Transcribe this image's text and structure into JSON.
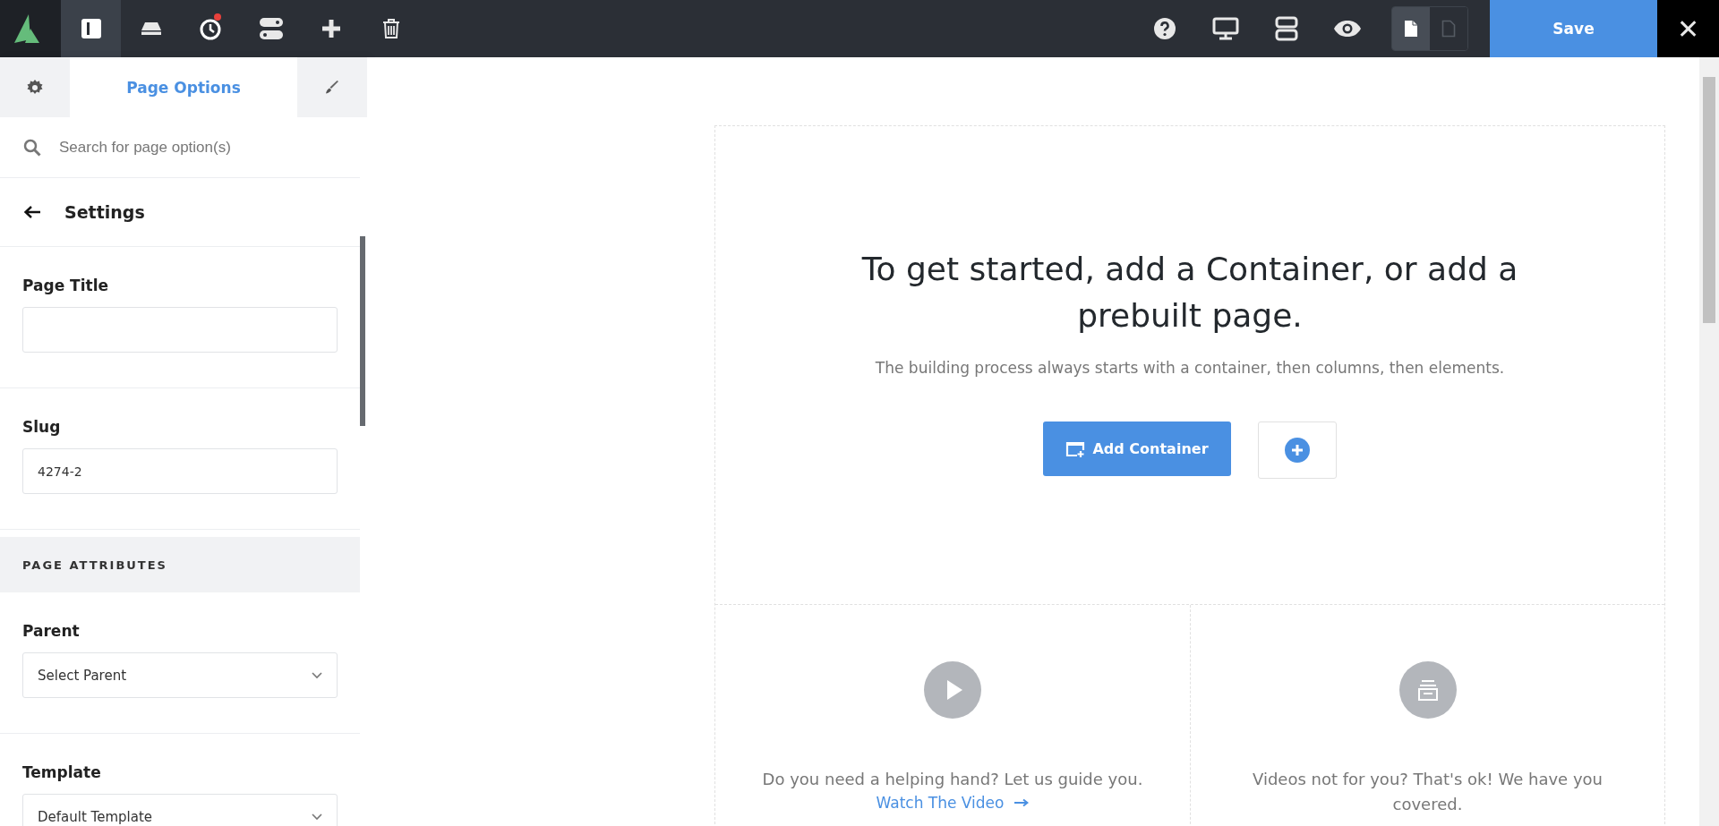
{
  "toolbar": {
    "left_tools": [
      {
        "kind": "sidebar",
        "selected": true,
        "notification": false
      },
      {
        "kind": "drive",
        "selected": false,
        "notification": false
      },
      {
        "kind": "history",
        "selected": false,
        "notification": true
      },
      {
        "kind": "toggles",
        "selected": false,
        "notification": false
      },
      {
        "kind": "add",
        "selected": false,
        "notification": false
      },
      {
        "kind": "delete",
        "selected": false,
        "notification": false
      }
    ],
    "right_tools": [
      {
        "kind": "help"
      },
      {
        "kind": "desktop"
      },
      {
        "kind": "layers"
      },
      {
        "kind": "preview"
      }
    ],
    "view_toggle": [
      {
        "kind": "page",
        "selected": true
      },
      {
        "kind": "page",
        "selected": false
      }
    ],
    "save_label": "Save",
    "close_label": "✕"
  },
  "sidebar": {
    "tabs": [
      {
        "kind": "settings",
        "selected": false
      },
      {
        "kind": "text",
        "label": "Page Options",
        "selected": true
      },
      {
        "kind": "brush",
        "selected": false
      }
    ],
    "search": {
      "placeholder": "Search for page option(s)"
    },
    "back_title": "Settings",
    "sections": [
      {
        "kind": "field",
        "label": "Page Title"
      },
      {
        "kind": "field",
        "label": "Slug",
        "value": "4274-2"
      },
      {
        "kind": "heading",
        "label": "PAGE ATTRIBUTES"
      },
      {
        "kind": "select",
        "label": "Parent",
        "value": "Select Parent"
      },
      {
        "kind": "select",
        "label": "Template",
        "value": "Default Template"
      }
    ]
  },
  "canvas": {
    "heading": "To get started, add a Container, or add a prebuilt page.",
    "subtitle": "The building process always starts with a container, then columns, then elements.",
    "add_container_label": "Add Container",
    "cards": [
      {
        "kind": "video",
        "text": "Do you need a helping hand? Let us guide you.",
        "link": "Watch The Video"
      },
      {
        "kind": "docs",
        "text": "Videos not for you? That's ok! We have you covered."
      }
    ]
  }
}
